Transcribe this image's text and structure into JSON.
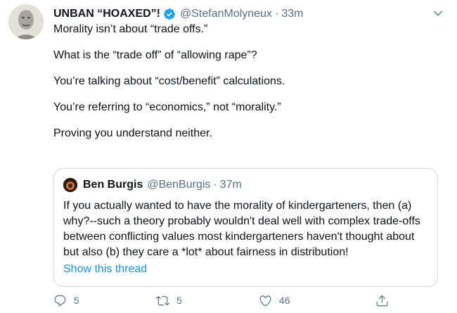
{
  "tweet": {
    "display_name": "UNBAN “HOAXED”!",
    "handle": "@StefanMolyneux",
    "separator": "·",
    "time": "33m",
    "paragraphs": [
      "Morality isn’t about “trade offs.”",
      "What is the “trade off” of “allowing rape”?",
      "You’re talking about “cost/benefit” calculations.",
      "You’re referring to “economics,” not “morality.”",
      "Proving you understand neither."
    ]
  },
  "quoted": {
    "display_name": "Ben Burgis",
    "handle": "@BenBurgis",
    "separator": "·",
    "time": "37m",
    "text": "If you actually wanted to have the morality of kindergarteners, then (a) why?--such a theory probably wouldn't deal well with complex trade-offs between conflicting values most kindergarteners haven't thought about but also (b) they care a *lot* about fairness in distribution!",
    "show_thread": "Show this thread"
  },
  "actions": {
    "reply_count": "5",
    "retweet_count": "5",
    "like_count": "46"
  },
  "icons": [
    "verified-badge-icon",
    "chevron-down-icon",
    "reply-icon",
    "retweet-icon",
    "like-icon",
    "share-icon"
  ],
  "colors": {
    "link": "#1b95e0",
    "verified": "#1da1f2",
    "secondary_text": "#5b7083",
    "border": "#cfd9de"
  }
}
